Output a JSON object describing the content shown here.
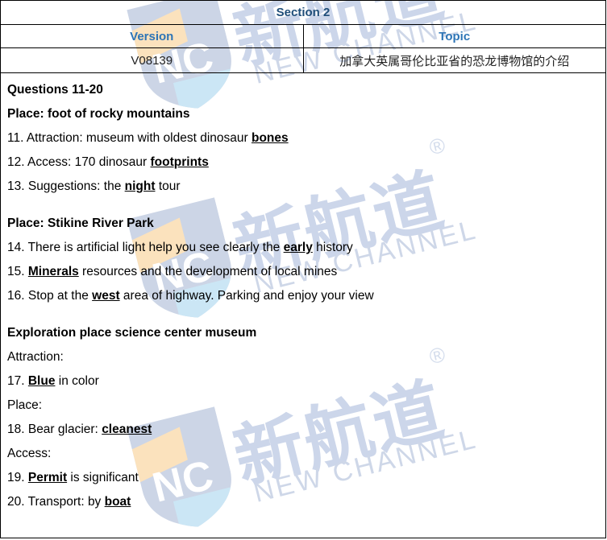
{
  "header": {
    "section_title": "Section 2",
    "col_version_label": "Version",
    "col_topic_label": "Topic",
    "version_value": "V08139",
    "topic_value": "加拿大英属哥伦比亚省的恐龙博物馆的介绍",
    "section_title_color": "#1f4e79",
    "col_header_color": "#2e75b6"
  },
  "watermark": {
    "logo_text": "NC",
    "chinese_text": "新航道",
    "english_text": "NEW CHANNEL",
    "registered_mark": "®",
    "shield_color": "#ccd5e6",
    "accent_orange": "#fbe2bd",
    "accent_blue": "#cbe6f5"
  },
  "body": {
    "lines": [
      {
        "id": "questions-heading",
        "bold": true,
        "parts": [
          {
            "t": "Questions 11-20"
          }
        ]
      },
      {
        "id": "place-heading-1",
        "bold": true,
        "parts": [
          {
            "t": "Place: foot of rocky mountains"
          }
        ]
      },
      {
        "id": "question-11",
        "bold": false,
        "parts": [
          {
            "t": "11. Attraction: museum with oldest dinosaur "
          },
          {
            "t": "bones",
            "answer": true
          }
        ]
      },
      {
        "id": "question-12",
        "bold": false,
        "parts": [
          {
            "t": "12. Access: 170 dinosaur "
          },
          {
            "t": "footprints",
            "answer": true
          }
        ]
      },
      {
        "id": "question-13",
        "bold": false,
        "parts": [
          {
            "t": "13. Suggestions: the "
          },
          {
            "t": "night",
            "answer": true
          },
          {
            "t": " tour"
          }
        ]
      },
      {
        "id": "spacer-1",
        "spacer": true,
        "parts": []
      },
      {
        "id": "place-heading-2",
        "bold": true,
        "parts": [
          {
            "t": "Place: Stikine River Park"
          }
        ]
      },
      {
        "id": "question-14",
        "bold": false,
        "parts": [
          {
            "t": "14. There is artificial light help you see clearly the "
          },
          {
            "t": "early",
            "answer": true
          },
          {
            "t": " history"
          }
        ]
      },
      {
        "id": "question-15",
        "bold": false,
        "parts": [
          {
            "t": "15. "
          },
          {
            "t": "Minerals",
            "answer": true
          },
          {
            "t": " resources and the development of local mines"
          }
        ]
      },
      {
        "id": "question-16",
        "bold": false,
        "parts": [
          {
            "t": "16. Stop at the "
          },
          {
            "t": "west",
            "answer": true
          },
          {
            "t": " area of highway. Parking and enjoy your view"
          }
        ]
      },
      {
        "id": "spacer-2",
        "spacer": true,
        "parts": []
      },
      {
        "id": "place-heading-3",
        "bold": true,
        "parts": [
          {
            "t": "Exploration place science center museum"
          }
        ]
      },
      {
        "id": "label-attraction",
        "bold": false,
        "parts": [
          {
            "t": "Attraction:"
          }
        ]
      },
      {
        "id": "question-17",
        "bold": false,
        "parts": [
          {
            "t": "17. "
          },
          {
            "t": "Blue",
            "answer": true
          },
          {
            "t": " in color"
          }
        ]
      },
      {
        "id": "label-place",
        "bold": false,
        "parts": [
          {
            "t": "Place:"
          }
        ]
      },
      {
        "id": "question-18",
        "bold": false,
        "parts": [
          {
            "t": "18. Bear glacier: "
          },
          {
            "t": "cleanest",
            "answer": true
          }
        ]
      },
      {
        "id": "label-access",
        "bold": false,
        "parts": [
          {
            "t": "Access:"
          }
        ]
      },
      {
        "id": "question-19",
        "bold": false,
        "parts": [
          {
            "t": "19. "
          },
          {
            "t": "Permit",
            "answer": true
          },
          {
            "t": " is significant"
          }
        ]
      },
      {
        "id": "question-20",
        "bold": false,
        "parts": [
          {
            "t": "20. Transport: by "
          },
          {
            "t": "boat",
            "answer": true
          }
        ]
      }
    ]
  }
}
